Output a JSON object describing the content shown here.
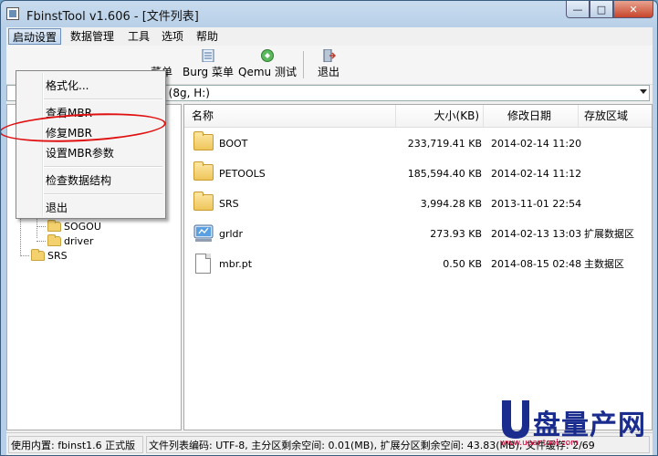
{
  "window": {
    "title": "FbinstTool v1.606 - [文件列表]"
  },
  "menubar": [
    "启动设置",
    "数据管理",
    "工具",
    "选项",
    "帮助"
  ],
  "toolbar": {
    "partial_label": "菜单",
    "burg_label": "Burg 菜单",
    "qemu_label": "Qemu 测试",
    "exit_label": "退出"
  },
  "device_combo": {
    "value": "ric (8g, H:)"
  },
  "dropdown": {
    "items": [
      "格式化...",
      "查看MBR",
      "修复MBR",
      "设置MBR参数",
      "检查数据结构",
      "退出"
    ]
  },
  "tree": {
    "nodes": [
      "SOGOU",
      "driver",
      "SRS"
    ]
  },
  "list": {
    "columns": [
      "名称",
      "大小(KB)",
      "修改日期",
      "存放区域"
    ],
    "rows": [
      {
        "name": "BOOT",
        "size": "233,719.41 KB",
        "date": "2014-02-14 11:20",
        "area": "",
        "icon": "folder-icon"
      },
      {
        "name": "PETOOLS",
        "size": "185,594.40 KB",
        "date": "2014-02-14 11:12",
        "area": "",
        "icon": "folder-icon"
      },
      {
        "name": "SRS",
        "size": "3,994.28 KB",
        "date": "2013-11-01 22:54",
        "area": "",
        "icon": "folder-icon"
      },
      {
        "name": "grldr",
        "size": "273.93 KB",
        "date": "2014-02-13 13:03",
        "area": "扩展数据区",
        "icon": "program-icon"
      },
      {
        "name": "mbr.pt",
        "size": "0.50 KB",
        "date": "2014-08-15 02:48",
        "area": "主数据区",
        "icon": "file-icon"
      }
    ]
  },
  "statusbar": {
    "left": "使用内置: fbinst1.6 正式版",
    "right": "文件列表编码: UTF-8, 主分区剩余空间: 0.01(MB), 扩展分区剩余空间: 43.83(MB), 文件缓存: 2/69"
  },
  "watermark": {
    "text": "盘量产网",
    "url": "www.upantool.com",
    "color": "#1a2c8e"
  }
}
